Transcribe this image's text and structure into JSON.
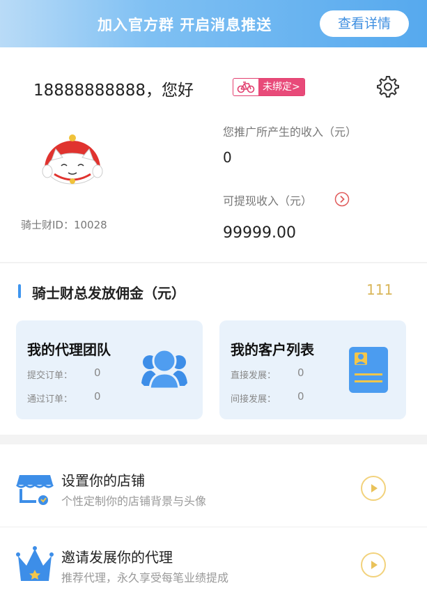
{
  "banner": {
    "text": "加入官方群 开启消息推送",
    "button_label": "查看详情"
  },
  "profile": {
    "greeting": "18888888888，您好",
    "bind_status": "未绑定",
    "bind_arrow": ">",
    "rider_id": "骑士财ID：10028"
  },
  "income": {
    "promo_label": "您推广所产生的收入（元）",
    "promo_value": "0",
    "withdraw_label": "可提现收入（元）",
    "withdraw_value": "99999.00"
  },
  "commission": {
    "title": "骑士财总发放佣金（元）",
    "value": "111"
  },
  "cards": {
    "team": {
      "title": "我的代理团队",
      "row1_label": "提交订单：",
      "row1_value": "0",
      "row2_label": "通过订单：",
      "row2_value": "0"
    },
    "clients": {
      "title": "我的客户列表",
      "row1_label": "直接发展：",
      "row1_value": "0",
      "row2_label": "间接发展：",
      "row2_value": "0"
    }
  },
  "menu": {
    "shop": {
      "title": "设置你的店铺",
      "subtitle": "个性定制你的店铺背景与头像"
    },
    "invite": {
      "title": "邀请发展你的代理",
      "subtitle": "推荐代理，永久享受每笔业绩提成"
    }
  },
  "icons": {
    "settings": "gear-icon",
    "bike": "bicycle-icon",
    "withdraw_arrow": "chevron-right-circle-icon",
    "team": "users-icon",
    "clients": "contact-card-icon",
    "shop": "storefront-icon",
    "invite": "crown-icon",
    "play": "play-circle-icon"
  },
  "colors": {
    "accent_blue": "#3e95ef",
    "badge_pink": "#e84a79",
    "gold": "#d9b65a",
    "card_bg": "#e9f2fb"
  }
}
